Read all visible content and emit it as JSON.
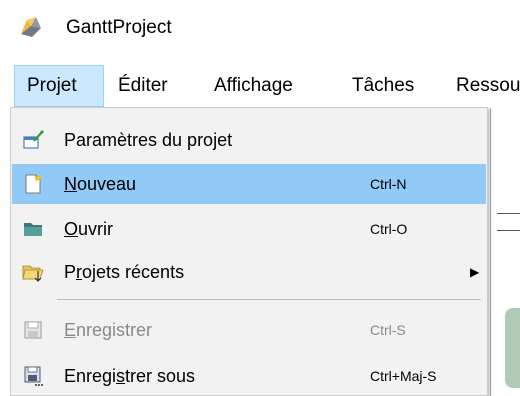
{
  "app": {
    "title": "GanttProject",
    "icon": "ganttproject-logo-icon"
  },
  "menubar": {
    "items": [
      {
        "label": "Projet",
        "active": true
      },
      {
        "label": "Éditer",
        "active": false
      },
      {
        "label": "Affichage",
        "active": false
      },
      {
        "label": "Tâches",
        "active": false
      },
      {
        "label": "Ressou",
        "active": false
      }
    ]
  },
  "menu": {
    "items": [
      {
        "label_a": "",
        "label_u": "",
        "label_b": "Paramètres du projet",
        "shortcut": "",
        "icon": "project-settings-icon",
        "enabled": true,
        "highlighted": false
      },
      {
        "label_a": "",
        "label_u": "N",
        "label_b": "ouveau",
        "shortcut": "Ctrl-N",
        "icon": "new-document-icon",
        "enabled": true,
        "highlighted": true
      },
      {
        "label_a": "",
        "label_u": "O",
        "label_b": "uvrir",
        "shortcut": "Ctrl-O",
        "icon": "open-folder-icon",
        "enabled": true,
        "highlighted": false
      },
      {
        "label_a": "P",
        "label_u": "r",
        "label_b": "ojets récents",
        "shortcut": "",
        "icon": "recent-projects-icon",
        "enabled": true,
        "highlighted": false,
        "submenu": "▶"
      },
      {
        "label_a": "",
        "label_u": "E",
        "label_b": "nregistrer",
        "shortcut": "Ctrl-S",
        "icon": "save-icon",
        "enabled": false,
        "highlighted": false
      },
      {
        "label_a": "Enregi",
        "label_u": "s",
        "label_b": "trer sous",
        "shortcut": "Ctrl+Maj-S",
        "icon": "save-as-icon",
        "enabled": true,
        "highlighted": false
      }
    ]
  },
  "colors": {
    "highlight": "#91c9f7",
    "menubar_active": "#cce8ff",
    "menu_background": "#f2f2f2",
    "disabled_text": "#8a8a8a"
  }
}
